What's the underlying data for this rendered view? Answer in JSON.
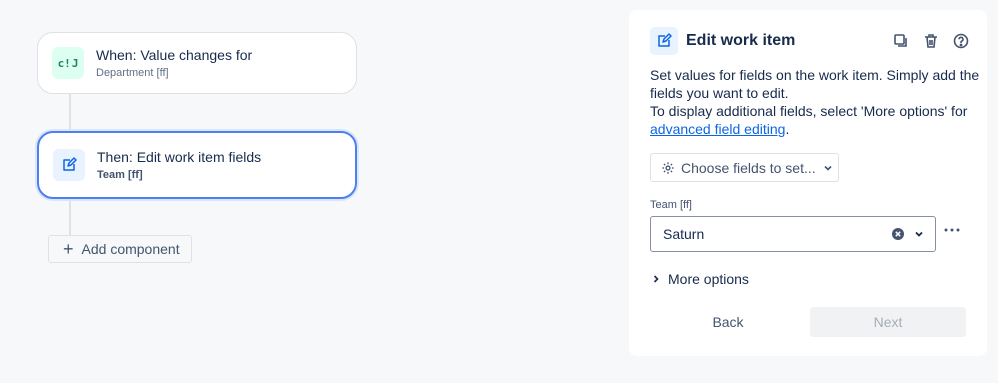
{
  "canvas": {
    "trigger": {
      "title": "When: Value changes for",
      "subtitle": "Department [ff]",
      "icon": "trigger-icon"
    },
    "action": {
      "title": "Then: Edit work item fields",
      "subtitle": "Team [ff]",
      "icon": "edit-icon"
    },
    "add_component_label": "Add component"
  },
  "panel": {
    "title": "Edit work item",
    "header_icons": [
      "copy-icon",
      "trash-icon",
      "help-icon"
    ],
    "description_line1": "Set values for fields on the work item. Simply add the fields you want to edit.",
    "description_line2_prefix": "To display additional fields, select 'More options' for",
    "description_link": "advanced field editing",
    "description_line2_suffix": ".",
    "choose_fields_label": "Choose fields to set...",
    "field": {
      "label": "Team [ff]",
      "value": "Saturn"
    },
    "more_options_label": "More options",
    "back_label": "Back",
    "next_label": "Next"
  },
  "colors": {
    "accent": "#0c66e4",
    "selected_border": "#4c7ff0",
    "trigger_bg": "#dcfff1"
  }
}
